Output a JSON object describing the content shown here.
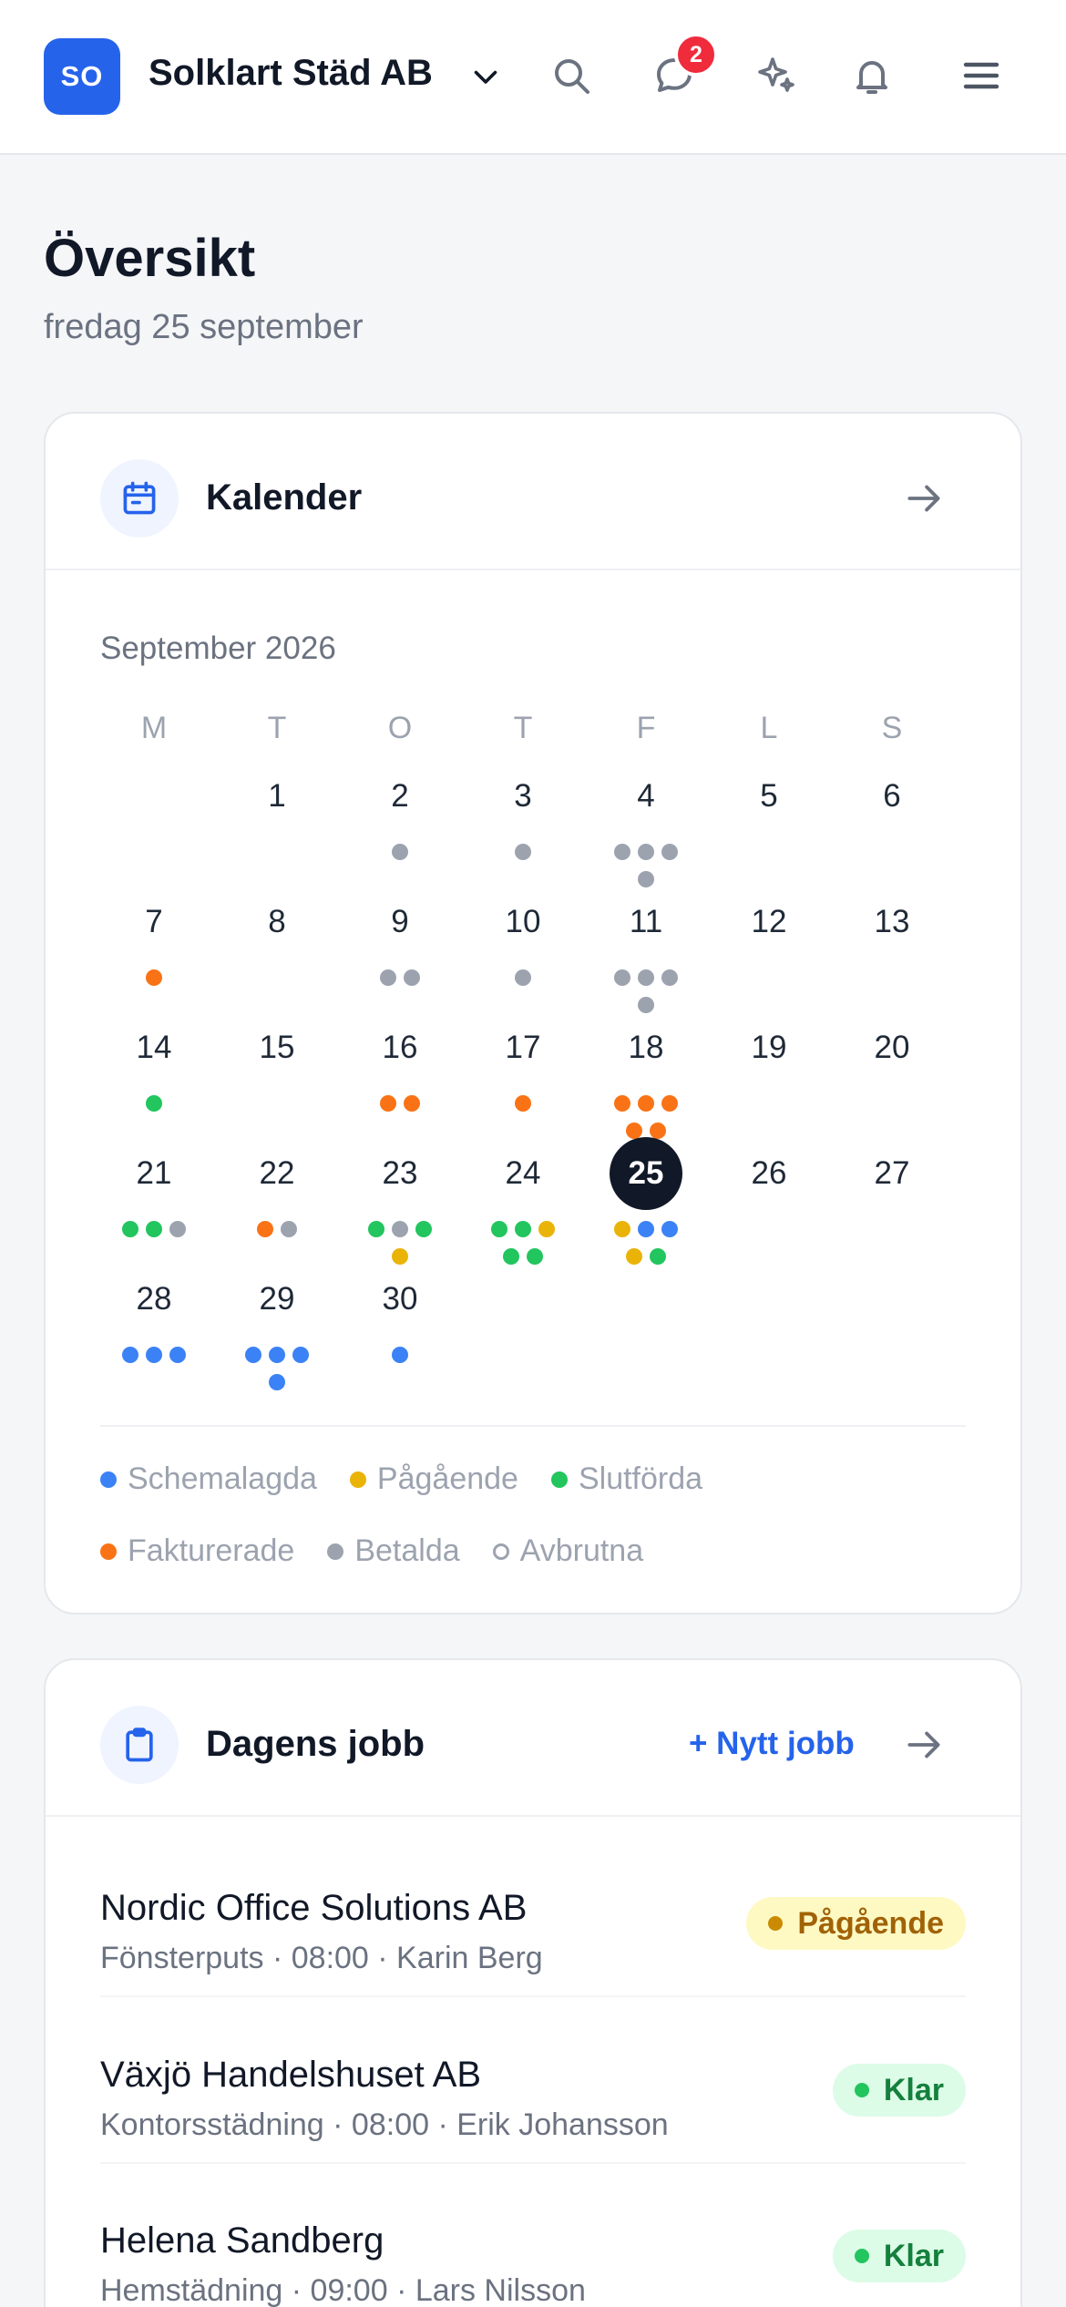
{
  "header": {
    "org_initials": "SO",
    "org_name": "Solklart Städ AB",
    "chat_badge": "2",
    "icons": [
      "chevron-down-icon",
      "search-icon",
      "chat-icon",
      "sparkle-icon",
      "bell-icon",
      "menu-icon"
    ]
  },
  "page": {
    "title": "Översikt",
    "subtitle": "fredag 25 september"
  },
  "calendar": {
    "title": "Kalender",
    "month": "September 2026",
    "weekdays": [
      "M",
      "T",
      "O",
      "T",
      "F",
      "L",
      "S"
    ],
    "first_weekday_index": 1,
    "days_in_month": 30,
    "today": 25,
    "status_colors": {
      "scheduled": "#3b82f6",
      "ongoing": "#eab308",
      "completed": "#22c55e",
      "invoiced": "#f97316",
      "paid": "#9ca3af"
    },
    "day_status": {
      "2": [
        "paid"
      ],
      "3": [
        "paid"
      ],
      "4": [
        "paid",
        "paid",
        "paid",
        "paid"
      ],
      "7": [
        "invoiced"
      ],
      "9": [
        "paid",
        "paid"
      ],
      "10": [
        "paid"
      ],
      "11": [
        "paid",
        "paid",
        "paid",
        "paid"
      ],
      "14": [
        "completed"
      ],
      "16": [
        "invoiced",
        "invoiced"
      ],
      "17": [
        "invoiced"
      ],
      "18": [
        "invoiced",
        "invoiced",
        "invoiced",
        "invoiced",
        "invoiced"
      ],
      "21": [
        "completed",
        "completed",
        "paid"
      ],
      "22": [
        "invoiced",
        "paid"
      ],
      "23": [
        "completed",
        "paid",
        "completed",
        "ongoing"
      ],
      "24": [
        "completed",
        "completed",
        "ongoing",
        "completed",
        "completed"
      ],
      "25": [
        "ongoing",
        "scheduled",
        "scheduled",
        "ongoing",
        "completed"
      ],
      "28": [
        "scheduled",
        "scheduled",
        "scheduled"
      ],
      "29": [
        "scheduled",
        "scheduled",
        "scheduled",
        "scheduled"
      ],
      "30": [
        "scheduled"
      ]
    },
    "legend": [
      {
        "label": "Schemalagda",
        "color": "#3b82f6"
      },
      {
        "label": "Pågående",
        "color": "#eab308"
      },
      {
        "label": "Slutförda",
        "color": "#22c55e"
      },
      {
        "label": "Fakturerade",
        "color": "#f97316"
      },
      {
        "label": "Betalda",
        "color": "#9ca3af"
      },
      {
        "label": "Avbrutna",
        "color": "hollow"
      }
    ]
  },
  "jobs": {
    "title": "Dagens jobb",
    "new_job_label": "+ Nytt jobb",
    "items": [
      {
        "customer": "Nordic Office Solutions AB",
        "meta": "Fönsterputs · 08:00 · Karin Berg",
        "status": "Pågående",
        "status_bg": "#fef9c3",
        "status_fg": "#a16207",
        "status_dot": "#ca8a04"
      },
      {
        "customer": "Växjö Handelshuset AB",
        "meta": "Kontorsstädning · 08:00 · Erik Johansson",
        "status": "Klar",
        "status_bg": "#dcfce7",
        "status_fg": "#15803d",
        "status_dot": "#22c55e"
      },
      {
        "customer": "Helena Sandberg",
        "meta": "Hemstädning · 09:00 · Lars Nilsson",
        "status": "Klar",
        "status_bg": "#dcfce7",
        "status_fg": "#15803d",
        "status_dot": "#22c55e"
      }
    ]
  }
}
